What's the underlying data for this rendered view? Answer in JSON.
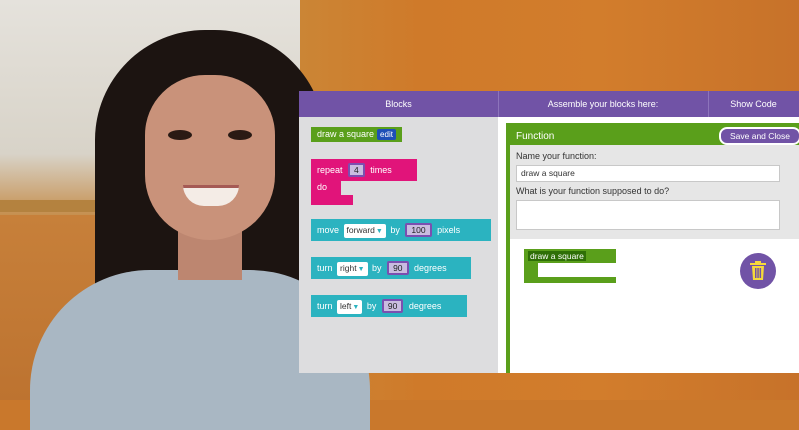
{
  "topbar": {
    "blocks_label": "Blocks",
    "assemble_label": "Assemble your blocks here:",
    "show_code_label": "Show Code"
  },
  "toolbox": {
    "draw_block": {
      "label": "draw a square",
      "edit_label": "edit"
    },
    "repeat_block": {
      "prefix": "repeat",
      "count": "4",
      "suffix": "times",
      "do_label": "do"
    },
    "move_block": {
      "prefix": "move",
      "direction": "forward",
      "by": "by",
      "amount": "100",
      "unit": "pixels"
    },
    "turn_right_block": {
      "prefix": "turn",
      "direction": "right",
      "by": "by",
      "amount": "90",
      "unit": "degrees"
    },
    "turn_left_block": {
      "prefix": "turn",
      "direction": "left",
      "by": "by",
      "amount": "90",
      "unit": "degrees"
    }
  },
  "function_editor": {
    "title": "Function",
    "save_label": "Save and Close",
    "name_label": "Name your function:",
    "name_value": "draw a square",
    "description_label": "What is your function supposed to do?",
    "description_value": "",
    "canvas_block_label": "draw a square"
  },
  "colors": {
    "purple": "#7153a6",
    "green": "#5a9f1b",
    "pink": "#e1147a",
    "teal": "#2bb3c0"
  },
  "icons": {
    "trash": "trash-icon",
    "dropdown": "chevron-down-icon"
  }
}
